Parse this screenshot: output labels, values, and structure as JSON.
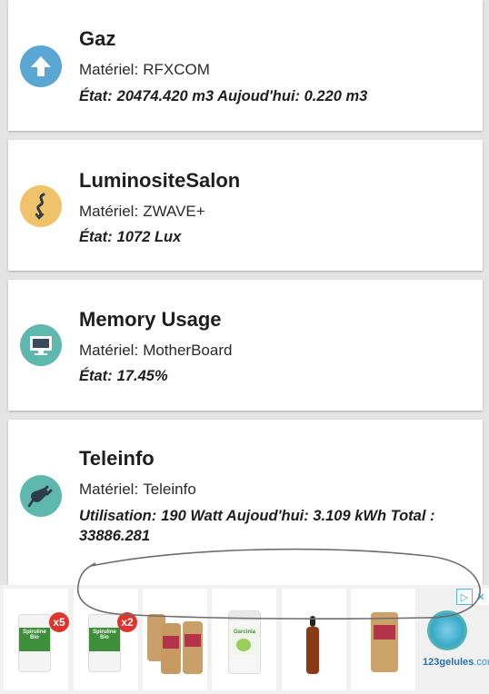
{
  "devices": [
    {
      "name": "Gaz",
      "hardware_label": "Matériel:",
      "hardware": "RFXCOM",
      "state_label": "État:",
      "state": "20474.420 m3 Aujoud'hui: 0.220 m3",
      "icon": "arrow-up-icon",
      "icon_color": "#5ba7d4"
    },
    {
      "name": "LuminositeSalon",
      "hardware_label": "Matériel:",
      "hardware": "ZWAVE+",
      "state_label": "État:",
      "state": "1072 Lux",
      "icon": "squiggle-icon",
      "icon_color": "#f0c36a"
    },
    {
      "name": "Memory Usage",
      "hardware_label": "Matériel:",
      "hardware": "MotherBoard",
      "state_label": "État:",
      "state": "17.45%",
      "icon": "monitor-icon",
      "icon_color": "#5fb8ad"
    },
    {
      "name": "Teleinfo",
      "hardware_label": "Matériel:",
      "hardware": "Teleinfo",
      "state_label": "Utilisation:",
      "state": "190 Watt Aujoud'hui: 3.109 kWh Total : 33886.281",
      "icon": "plug-icon",
      "icon_color": "#5fb8ad"
    }
  ],
  "ad": {
    "badges": [
      "x5",
      "x2"
    ],
    "product_labels": [
      "Spiruline Bio",
      "Spiruline Bio",
      "Garcinia"
    ],
    "brand": "123gelules",
    "brand_suffix": ".com",
    "adchoices_glyph": "▷",
    "close_glyph": "✕"
  }
}
